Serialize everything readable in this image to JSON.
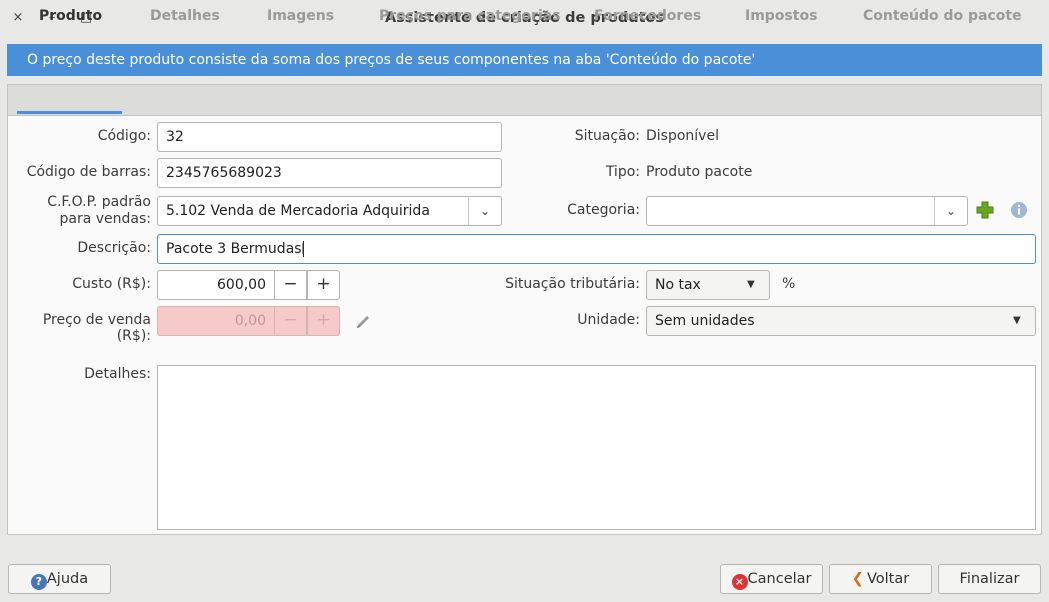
{
  "window": {
    "title": "Assistente de criação de produtos",
    "close_icon": "×",
    "minimize_icon": "–",
    "maximize_icon": "□"
  },
  "banner": {
    "text": "O preço deste produto consiste da soma dos preços de seus componentes na aba 'Conteúdo do pacote'"
  },
  "tabs": [
    {
      "label": "Produto"
    },
    {
      "label": "Detalhes"
    },
    {
      "label": "Imagens"
    },
    {
      "label": "Preços para categorias"
    },
    {
      "label": "Fornecedores"
    },
    {
      "label": "Impostos"
    },
    {
      "label": "Conteúdo do pacote"
    }
  ],
  "form": {
    "codigo": {
      "label": "Código:",
      "value": "32"
    },
    "codigo_barras": {
      "label": "Código de barras:",
      "value": "2345765689023"
    },
    "cfop": {
      "label_line1": "C.F.O.P. padrão",
      "label_line2": "para vendas:",
      "value": "5.102 Venda de Mercadoria Adquirida"
    },
    "descricao": {
      "label": "Descrição:",
      "value": "Pacote 3 Bermudas"
    },
    "custo": {
      "label": "Custo (R$):",
      "value": "600,00",
      "minus": "−",
      "plus": "+"
    },
    "preco_venda": {
      "label": "Preço de venda (R$):",
      "value": "0,00",
      "minus": "−",
      "plus": "+"
    },
    "detalhes": {
      "label": "Detalhes:",
      "value": ""
    },
    "situacao": {
      "label": "Situação:",
      "value": "Disponível"
    },
    "tipo": {
      "label": "Tipo:",
      "value": "Produto pacote"
    },
    "categoria": {
      "label": "Categoria:",
      "value": ""
    },
    "situacao_tributaria": {
      "label": "Situação tributária:",
      "value": "No tax",
      "suffix": "%"
    },
    "unidade": {
      "label": "Unidade:",
      "value": "Sem unidades"
    }
  },
  "buttons": {
    "ajuda": "Ajuda",
    "cancelar": "Cancelar",
    "voltar": "Voltar",
    "finalizar": "Finalizar"
  },
  "colors": {
    "accent": "#4a90d9",
    "error_bg": "#f7caca",
    "add_green": "#6aa51f"
  }
}
